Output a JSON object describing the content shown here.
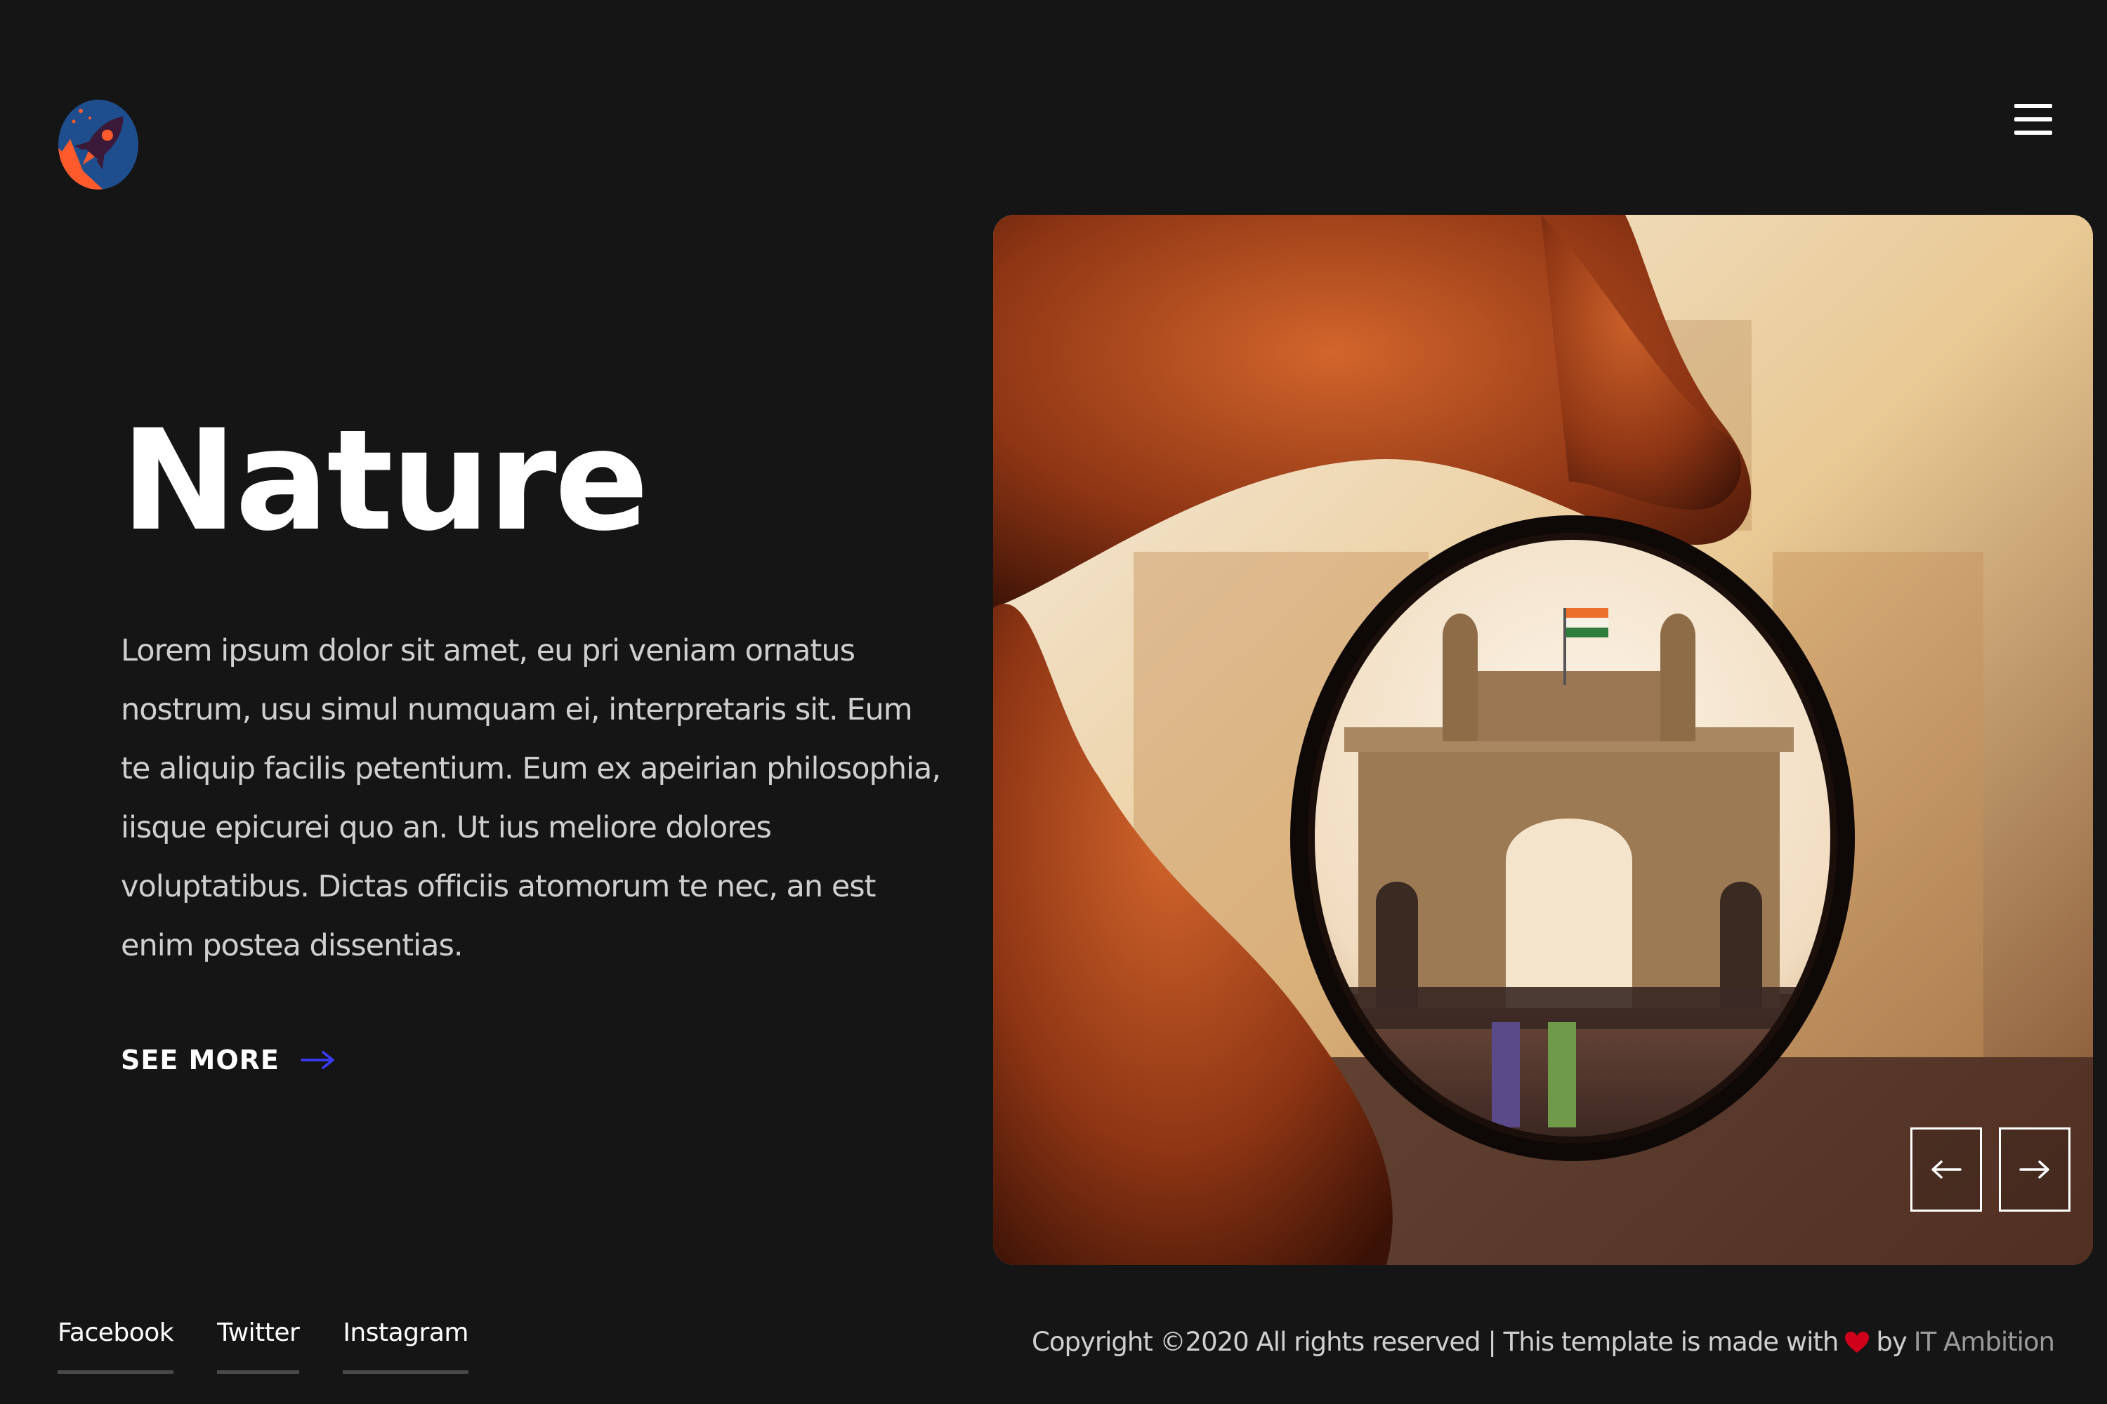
{
  "header": {
    "logo_icon": "rocket-icon",
    "menu_icon": "hamburger-icon"
  },
  "hero": {
    "title": "Nature",
    "description": "Lorem ipsum dolor sit amet, eu pri veniam ornatus nostrum, usu simul numquam ei, interpretaris sit. Eum te aliquip facilis petentium. Eum ex apeirian philosophia, iisque epicurei quo an. Ut ius meliore dolores voluptatibus. Dictas officiis atomorum te nec, an est enim postea dissentias.",
    "see_more_label": "SEE MORE",
    "see_more_icon": "arrow-right-icon"
  },
  "slider": {
    "prev_icon": "arrow-left-icon",
    "next_icon": "arrow-right-icon"
  },
  "footer": {
    "social": [
      {
        "label": "Facebook"
      },
      {
        "label": "Twitter"
      },
      {
        "label": "Instagram"
      }
    ],
    "copyright_text": "Copyright ©2020 All rights reserved | This template is made with",
    "copyright_by": "by",
    "copyright_author": "IT Ambition",
    "heart_icon": "heart-icon"
  },
  "colors": {
    "background": "#151515",
    "accent_arrow": "#3b3bff",
    "heart": "#d0021b",
    "text_muted": "#cfcfcf"
  }
}
